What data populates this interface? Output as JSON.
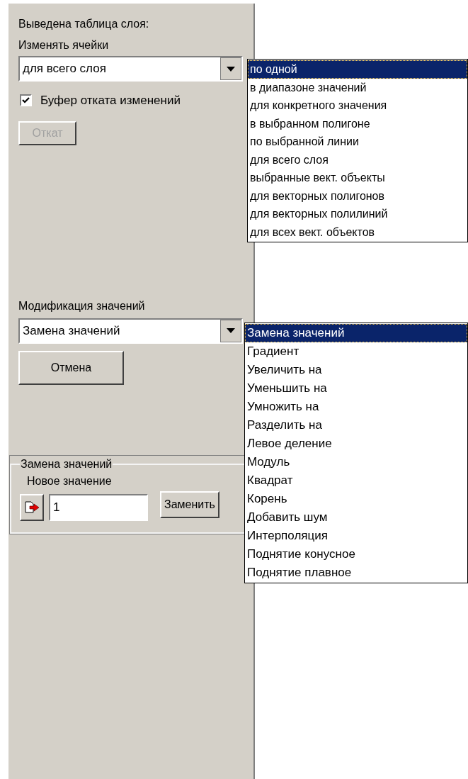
{
  "header": "Выведена таблица слоя:",
  "cells_label": "Изменять ячейки",
  "cells_combo": {
    "value": "для всего слоя",
    "expanded": true
  },
  "cells_options": [
    {
      "label": "по одной",
      "selected": true
    },
    {
      "label": "в диапазоне значений",
      "selected": false
    },
    {
      "label": "для конкретного значения",
      "selected": false
    },
    {
      "label": "в выбранном полигоне",
      "selected": false
    },
    {
      "label": "по выбранной линии",
      "selected": false
    },
    {
      "label": "для всего слоя",
      "selected": false
    },
    {
      "label": "выбранные вект. объекты",
      "selected": false
    },
    {
      "label": "для векторных полигонов",
      "selected": false
    },
    {
      "label": "для векторных полилиний",
      "selected": false
    },
    {
      "label": "для всех вект. объектов",
      "selected": false
    }
  ],
  "undo_buffer": {
    "label": "Буфер отката изменений",
    "checked": true
  },
  "rollback_button": {
    "label": "Откат",
    "disabled": true
  },
  "modify_label": "Модификация значений",
  "modify_combo": {
    "value": "Замена значений",
    "expanded": true
  },
  "modify_options": [
    {
      "label": "Замена значений",
      "selected": true
    },
    {
      "label": "Градиент",
      "selected": false
    },
    {
      "label": "Увеличить на",
      "selected": false
    },
    {
      "label": "Уменьшить на",
      "selected": false
    },
    {
      "label": "Умножить на",
      "selected": false
    },
    {
      "label": "Разделить на",
      "selected": false
    },
    {
      "label": "Левое деление",
      "selected": false
    },
    {
      "label": "Модуль",
      "selected": false
    },
    {
      "label": "Квадрат",
      "selected": false
    },
    {
      "label": "Корень",
      "selected": false
    },
    {
      "label": "Добавить шум",
      "selected": false
    },
    {
      "label": "Интерполяция",
      "selected": false
    },
    {
      "label": "Поднятие конусное",
      "selected": false
    },
    {
      "label": "Поднятие плавное",
      "selected": false
    }
  ],
  "cancel_button": {
    "label": "Отмена",
    "disabled": false
  },
  "replace_group": {
    "title": "Замена значений",
    "field_label": "Новое значение",
    "value": "1",
    "button": "Заменить"
  }
}
